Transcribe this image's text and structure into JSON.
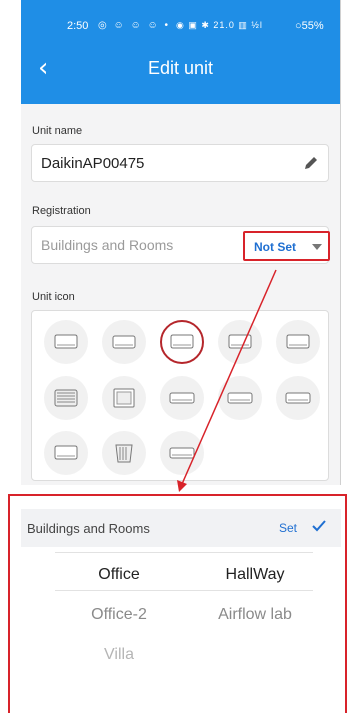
{
  "status_bar": {
    "time": "2:50",
    "left_icons": "◎ ☺ ☺ ☺ •",
    "right_icons": "◉ ▣ ✱ 21.0 ▥ ½l",
    "battery": "○55%"
  },
  "header": {
    "back_icon": "chevron-left-icon",
    "title": "Edit unit"
  },
  "unit_name": {
    "label": "Unit name",
    "value": "DaikinAP00475",
    "edit_icon": "pencil-icon"
  },
  "registration": {
    "label": "Registration",
    "placeholder": "Buildings and Rooms",
    "status": "Not Set"
  },
  "unit_icon": {
    "label": "Unit icon",
    "selected_index": 2,
    "count": 13
  },
  "picker": {
    "title": "Buildings and Rooms",
    "set_label": "Set",
    "options": [
      "Office",
      "HallWay",
      "Office-2",
      "Airflow lab",
      "Villa"
    ]
  },
  "colors": {
    "accent": "#1f8ee6",
    "highlight": "#d8232a",
    "link": "#1f6fd1"
  }
}
